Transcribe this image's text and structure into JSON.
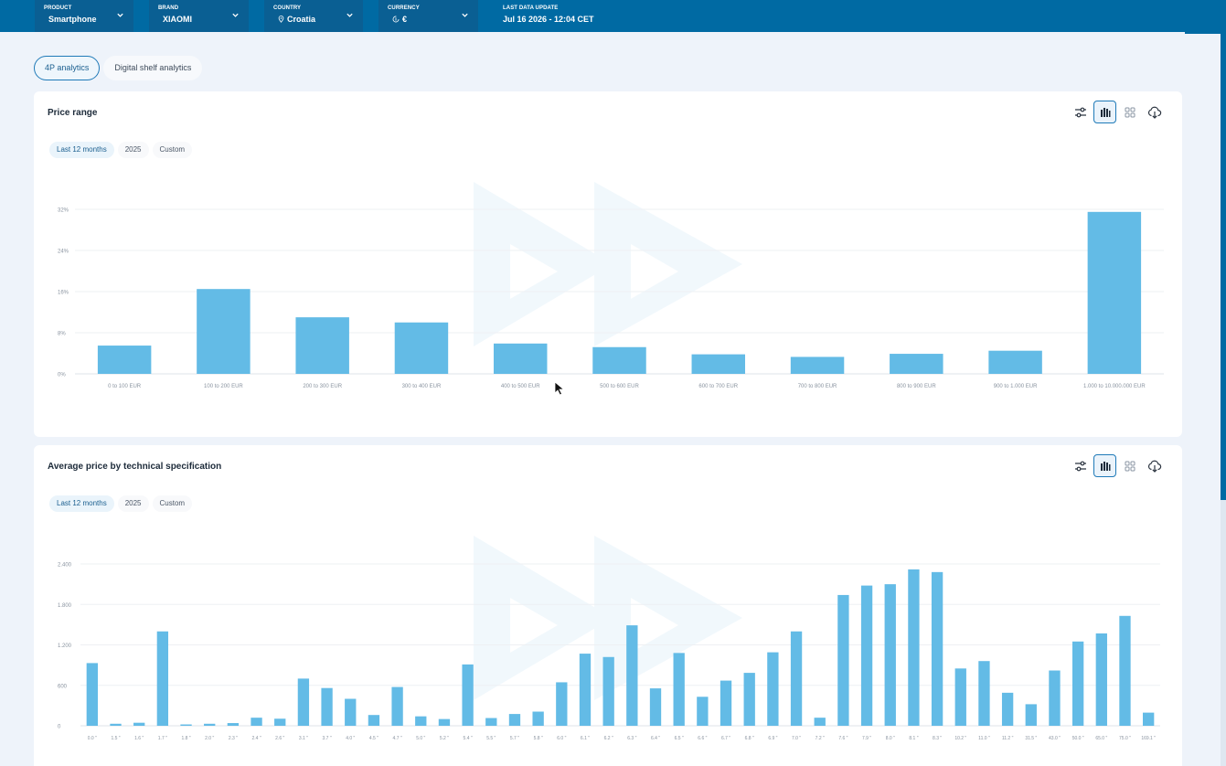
{
  "topbar": {
    "filters": [
      {
        "label": "PRODUCT",
        "value": "Smartphone",
        "icon": "",
        "name": "product"
      },
      {
        "label": "BRAND",
        "value": "XIAOMI",
        "icon": "",
        "name": "brand"
      },
      {
        "label": "COUNTRY",
        "value": "Croatia",
        "icon": "location-pin-icon",
        "name": "country"
      },
      {
        "label": "CURRENCY",
        "value": "€",
        "icon": "currency-icon",
        "name": "currency"
      }
    ],
    "update_label": "LAST DATA UPDATE",
    "update_value": "Jul 16 2026 - 12:04 CET"
  },
  "tabs": [
    {
      "label": "4P analytics",
      "active": true
    },
    {
      "label": "Digital shelf analytics",
      "active": false
    }
  ],
  "colors": {
    "accent": "#006aa3",
    "bar": "#63bbe6",
    "grid": "#eef0f3"
  },
  "cards": [
    {
      "title": "Price range",
      "periods": [
        "Last 12 months",
        "2025",
        "Custom"
      ],
      "active_period": 0
    },
    {
      "title": "Average price by technical specification",
      "periods": [
        "Last 12 months",
        "2025",
        "Custom"
      ],
      "active_period": 0
    }
  ],
  "chart_data": [
    {
      "type": "bar",
      "categories": [
        "0 to 100 EUR",
        "100 to 200 EUR",
        "200 to 300 EUR",
        "300 to 400 EUR",
        "400 to 500 EUR",
        "500 to 600 EUR",
        "600 to 700 EUR",
        "700 to 800 EUR",
        "800 to 900 EUR",
        "900 to 1.000 EUR",
        "1.000 to 10.000.000 EUR"
      ],
      "values": [
        5.5,
        16.5,
        11,
        10,
        5.9,
        5.2,
        3.8,
        3.3,
        3.9,
        4.5,
        31.5
      ],
      "yticks": [
        "32%",
        "24%",
        "16%",
        "8%",
        "0%"
      ],
      "ylim": [
        0,
        32
      ],
      "grid": true
    },
    {
      "type": "bar",
      "categories": [
        "0.0 \"",
        "1.5 \"",
        "1.6 \"",
        "1.7 \"",
        "1.8 \"",
        "2.0 \"",
        "2.3 \"",
        "2.4 \"",
        "2.6 \"",
        "3.1 \"",
        "3.7 \"",
        "4.0 \"",
        "4.5 \"",
        "4.7 \"",
        "5.0 \"",
        "5.2 \"",
        "5.4 \"",
        "5.5 \"",
        "5.7 \"",
        "5.8 \"",
        "6.0 \"",
        "6.1 \"",
        "6.2 \"",
        "6.3 \"",
        "6.4 \"",
        "6.5 \"",
        "6.6 \"",
        "6.7 \"",
        "6.8 \"",
        "6.9 \"",
        "7.0 \"",
        "7.2 \"",
        "7.6 \"",
        "7.9 \"",
        "8.0 \"",
        "8.1 \"",
        "8.3 \"",
        "10.2 \"",
        "11.0 \"",
        "11.2 \"",
        "31.5 \"",
        "43.0 \"",
        "50.0 \"",
        "65.0 \"",
        "75.0 \"",
        "169.1 \""
      ],
      "values": [
        930,
        30,
        45,
        1400,
        20,
        30,
        40,
        120,
        105,
        700,
        560,
        400,
        160,
        575,
        140,
        100,
        910,
        115,
        175,
        210,
        645,
        1070,
        1020,
        1490,
        555,
        1080,
        430,
        670,
        785,
        1090,
        1400,
        120,
        1940,
        2080,
        2100,
        2320,
        2280,
        850,
        960,
        490,
        320,
        820,
        1250,
        1370,
        1630,
        195
      ],
      "yticks": [
        "2.400",
        "1.800",
        "1.200",
        "600",
        "0"
      ],
      "ylim": [
        0,
        2400
      ],
      "grid": true
    }
  ]
}
